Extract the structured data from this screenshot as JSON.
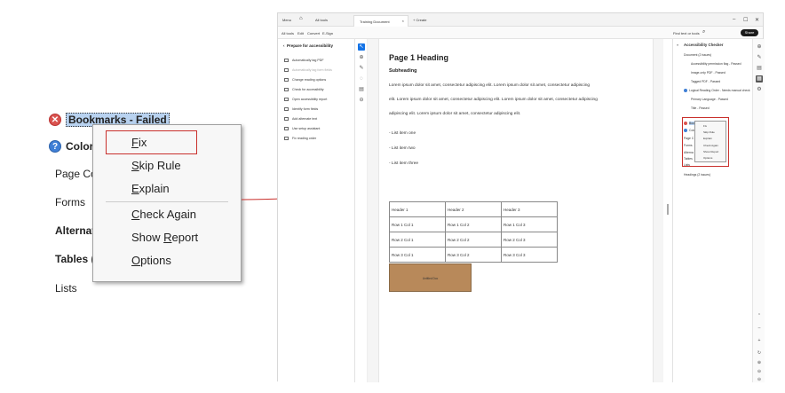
{
  "zoom": {
    "rows": [
      {
        "label": "Bookmarks - Failed",
        "status": "failed"
      },
      {
        "label": "Color",
        "status": "needs-check"
      },
      {
        "label": "Page Co"
      },
      {
        "label": "Forms"
      },
      {
        "label": "Alternat"
      },
      {
        "label": "Tables (1"
      },
      {
        "label": "Lists"
      }
    ],
    "status_glyphs": {
      "failed": "✕",
      "help": "?"
    }
  },
  "context_menu": {
    "items": [
      {
        "mn": "F",
        "rest": "ix"
      },
      {
        "mn": "S",
        "rest": "kip Rule"
      },
      {
        "mn": "E",
        "rest": "xplain"
      },
      {
        "mn": "C",
        "rest": "heck Again"
      },
      {
        "pre": "Show ",
        "mn": "R",
        "rest": "eport"
      },
      {
        "mn": "O",
        "rest": "ptions"
      }
    ]
  },
  "app": {
    "titlebar": {
      "menu": "Menu",
      "home": "⌂",
      "all_tools": "All tools",
      "doc_tab": "Training Document",
      "tab_close": "×",
      "new_tab": "+ Create",
      "window_controls": [
        "–",
        "☐",
        "✕"
      ]
    },
    "toolbar": {
      "items": [
        "All tools",
        "Edit",
        "Convert",
        "E-Sign"
      ],
      "find_label": "Find text or tools",
      "share": "Share"
    },
    "left_panel": {
      "title": "Prepare for accessibility",
      "items": [
        {
          "label": "Automatically tag PDF",
          "disabled": false
        },
        {
          "label": "Automatically tag form fields",
          "disabled": true
        },
        {
          "label": "Change reading options",
          "disabled": false
        },
        {
          "label": "Check for accessibility",
          "disabled": false
        },
        {
          "label": "Open accessibility report",
          "disabled": false
        },
        {
          "label": "Identify form fields",
          "disabled": false
        },
        {
          "label": "Add alternate text",
          "disabled": false
        },
        {
          "label": "Use setup assistant",
          "disabled": false
        },
        {
          "label": "Fix reading order",
          "disabled": false
        }
      ]
    },
    "tools": [
      "↖",
      "⊕",
      "✎",
      "◌",
      "▤",
      "⊖"
    ],
    "page": {
      "heading": "Page 1 Heading",
      "subheading": "Subheading",
      "paragraph_lines": [
        "Lorem ipsum dolor sit amet, consectetur adipiscing elit. Lorem ipsum dolor sit amet, consectetur adipiscing",
        "elit. Lorem ipsum dolor sit amet, consectetur adipiscing elit. Lorem ipsum dolor sit amet, consectetur adipiscing",
        "adipiscing elit. Lorem ipsum dolor sit amet, consectetur adipiscing elit."
      ],
      "list": [
        "- List item one",
        "- List item two",
        "- List item three"
      ],
      "table": [
        [
          "Header 1",
          "Header 2",
          "Header 3"
        ],
        [
          "Row 1 Col 1",
          "Row 1 Col 2",
          "Row 1 Col 3"
        ],
        [
          "Row 2 Col 1",
          "Row 2 Col 2",
          "Row 2 Col 3"
        ],
        [
          "Row 3 Col 1",
          "Row 3 Col 2",
          "Row 3 Col 3"
        ]
      ],
      "image_label": "Untitled Doc"
    },
    "right_panel": {
      "title": "Accessibility Checker",
      "items": [
        {
          "label": "Document (2 issues)",
          "level": 0
        },
        {
          "label": "Accessibility permission flag - Passed",
          "level": 2
        },
        {
          "label": "Image-only PDF - Passed",
          "level": 2
        },
        {
          "label": "Tagged PDF - Passed",
          "level": 2
        },
        {
          "label": "Logical Reading Order - Needs manual check",
          "level": 1
        },
        {
          "label": "Primary Language - Passed",
          "level": 2
        },
        {
          "label": "Title - Passed",
          "level": 2
        },
        {
          "label": "Bookmarks - Failed",
          "level": 1,
          "status": "failed"
        },
        {
          "label": "Color",
          "level": 1,
          "status": "help"
        },
        {
          "label": "Page C",
          "level": 1
        },
        {
          "label": "Forms",
          "level": 1
        },
        {
          "label": "Alterna",
          "level": 1
        },
        {
          "label": "Tables",
          "level": 1
        },
        {
          "label": "Lists",
          "level": 1
        },
        {
          "label": "Headings (2 issues)",
          "level": 0
        }
      ],
      "mini_menu": [
        "Fix",
        "Skip Rule",
        "Explain",
        "Check Again",
        "Show Report",
        "Options"
      ]
    },
    "rail_icons": [
      "⊕",
      "✎",
      "▤",
      "▦",
      "⚙"
    ],
    "rail_bottom_icons": [
      "⌃",
      "–",
      "+",
      "↻",
      "⊕",
      "⊖",
      "⊖"
    ]
  },
  "colors": {
    "fail_red": "#d9534f",
    "highlight_red": "#c9302c",
    "accent_blue": "#1473e6",
    "image_brown": "#b8895a"
  }
}
